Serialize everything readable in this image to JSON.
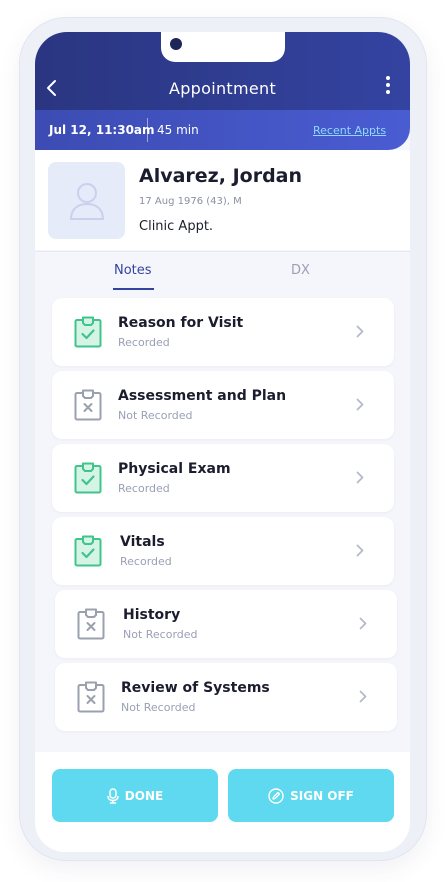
{
  "header": {
    "title": "Appointment",
    "back_icon": "chevron-left-icon",
    "more_icon": "more-vertical-icon",
    "colors": {
      "header": "#2a3680",
      "subbar": "#4a5cd2",
      "accent": "#3443a1"
    }
  },
  "subbar": {
    "datetime": "Jul 12, 11:30am",
    "duration": "45 min",
    "recent_link": "Recent Appts"
  },
  "patient": {
    "name": "Alvarez, Jordan",
    "dob": "17 Aug 1976 (43), M",
    "appt_type": "Clinic Appt.",
    "avatar_icon": "user-placeholder-icon"
  },
  "tabs": [
    {
      "label": "Notes",
      "active": true
    },
    {
      "label": "DX",
      "active": false
    }
  ],
  "notes": [
    {
      "title": "Reason for Visit",
      "status": "Recorded",
      "icon": "clipboard-check-icon",
      "recorded": true
    },
    {
      "title": "Assessment and Plan",
      "status": "Not Recorded",
      "icon": "clipboard-x-icon",
      "recorded": false
    },
    {
      "title": "Physical Exam",
      "status": "Recorded",
      "icon": "clipboard-check-icon",
      "recorded": true
    },
    {
      "title": "Vitals",
      "status": "Recorded",
      "icon": "clipboard-check-icon",
      "recorded": true
    },
    {
      "title": "History",
      "status": "Not Recorded",
      "icon": "clipboard-x-icon",
      "recorded": false
    },
    {
      "title": "Review of Systems",
      "status": "Not Recorded",
      "icon": "clipboard-x-icon",
      "recorded": false
    }
  ],
  "footer": {
    "done_label": "DONE",
    "done_icon": "microphone-icon",
    "signoff_label": "SIGN OFF",
    "signoff_icon": "edit-pen-icon",
    "button_color": "#5ed9ef"
  }
}
